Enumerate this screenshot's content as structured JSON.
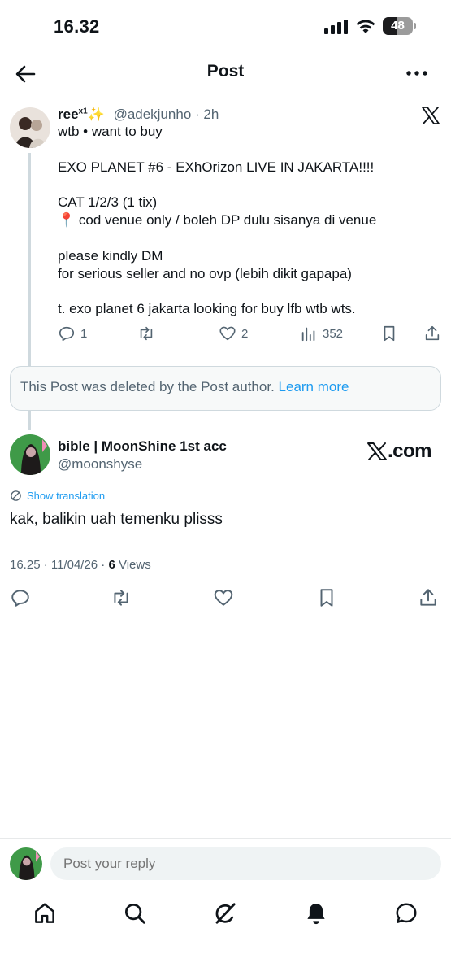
{
  "status": {
    "time": "16.32",
    "battery": "48",
    "battery_level": 0.48
  },
  "header": {
    "title": "Post"
  },
  "icons": {
    "back": "arrow-left-icon",
    "more": "more-horizontal-icon",
    "x_brand": "x-logo-icon",
    "reply": "reply-icon",
    "repost": "repost-icon",
    "like": "heart-icon",
    "views": "bar-chart-icon",
    "bookmark": "bookmark-icon",
    "share": "share-icon",
    "translate": "translate-icon"
  },
  "colors": {
    "accent": "#1d9bf0",
    "text": "#0f1419",
    "muted": "#536471",
    "border": "#cfd9de"
  },
  "parent_post": {
    "name": "ree",
    "name_suffix": "x1",
    "sparkle": "✨",
    "handle": "@adekjunho",
    "time": "2h",
    "lines": [
      "wtb • want to buy",
      "EXO PLANET #6 - EXhOrizon LIVE IN JAKARTA!!!!",
      "CAT 1/2/3 (1 tix)",
      "📍 cod venue only / boleh DP dulu sisanya di venue",
      "please kindly DM",
      "for serious seller and no ovp (lebih dikit gapapa)",
      "t. exo planet 6 jakarta looking for buy lfb wtb wts."
    ],
    "replies": "1",
    "likes": "2",
    "views": "352"
  },
  "deleted_notice": {
    "text": "This Post was deleted by the Post author.",
    "link": "Learn more"
  },
  "main_post": {
    "name": "bible | MoonShine 1st acc",
    "handle": "@moonshyse",
    "watermark": ".com",
    "translate_label": "Show translation",
    "text": "kak, balikin uah temenku plisss",
    "timestamp": "16.25 · 11/04/26 · ",
    "views_count": "6",
    "views_label": " Views"
  },
  "reply": {
    "placeholder": "Post your reply"
  },
  "nav": [
    "home-icon",
    "search-icon",
    "grok-icon",
    "notifications-bell-icon",
    "messages-icon"
  ]
}
